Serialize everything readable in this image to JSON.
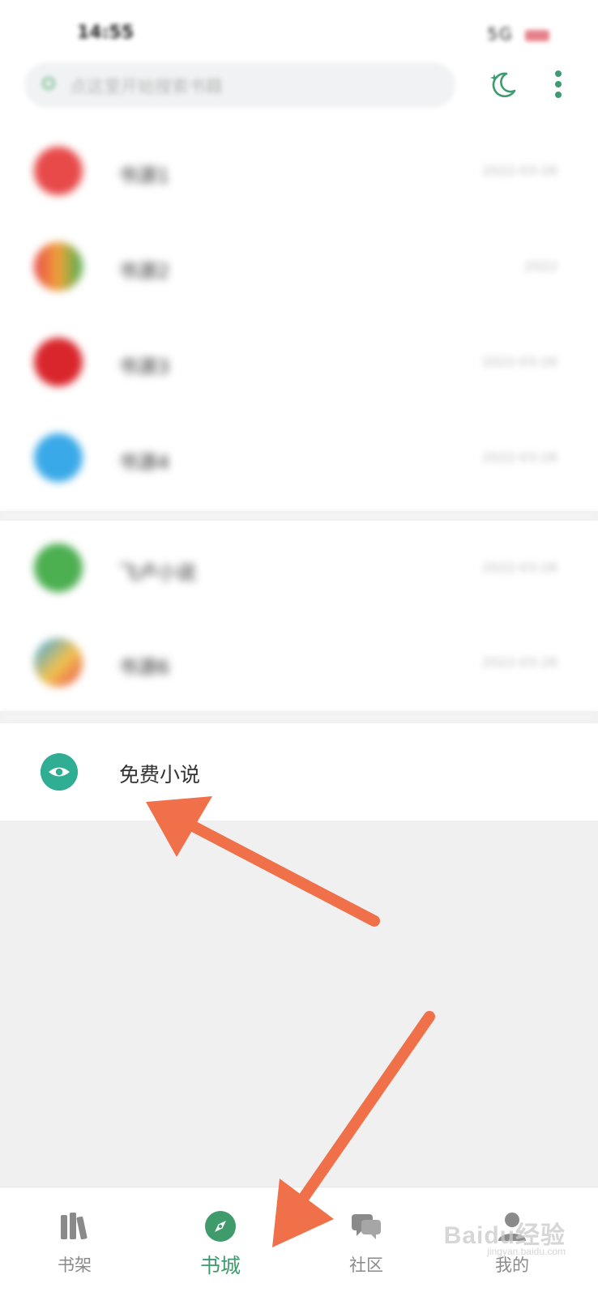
{
  "status_bar": {
    "time": "14:55",
    "icons": "5G"
  },
  "search": {
    "placeholder": "点这里开始搜索书籍"
  },
  "top_icons": {
    "night_mode_icon": "moon-icon",
    "more_icon": "more-vertical-icon"
  },
  "sources": [
    {
      "name": "书源1",
      "meta": "2022-03-26",
      "color": "#e84a4a"
    },
    {
      "name": "书源2",
      "meta": "2022",
      "color": "#f0a23a"
    },
    {
      "name": "书源3",
      "meta": "2022-03-26",
      "color": "#d9262c"
    },
    {
      "name": "书源4",
      "meta": "2022-03-26",
      "color": "#3aa9e8"
    },
    {
      "name": "飞卢小说",
      "meta": "2022-03-26",
      "color": "#4caf50"
    },
    {
      "name": "书源6",
      "meta": "2022-03-26",
      "color": "#f2c14e"
    }
  ],
  "free_novel": {
    "label": "免费小说",
    "icon": "eye-icon",
    "icon_color": "#2fae93"
  },
  "tabbar": {
    "shelf": "书架",
    "store": "书城",
    "community": "社区",
    "mine": "我的"
  },
  "watermark": {
    "text": "Baidu经验",
    "sub": "jingyan.baidu.com"
  },
  "colors": {
    "accent": "#3f9b6b",
    "arrow": "#f0704a"
  }
}
